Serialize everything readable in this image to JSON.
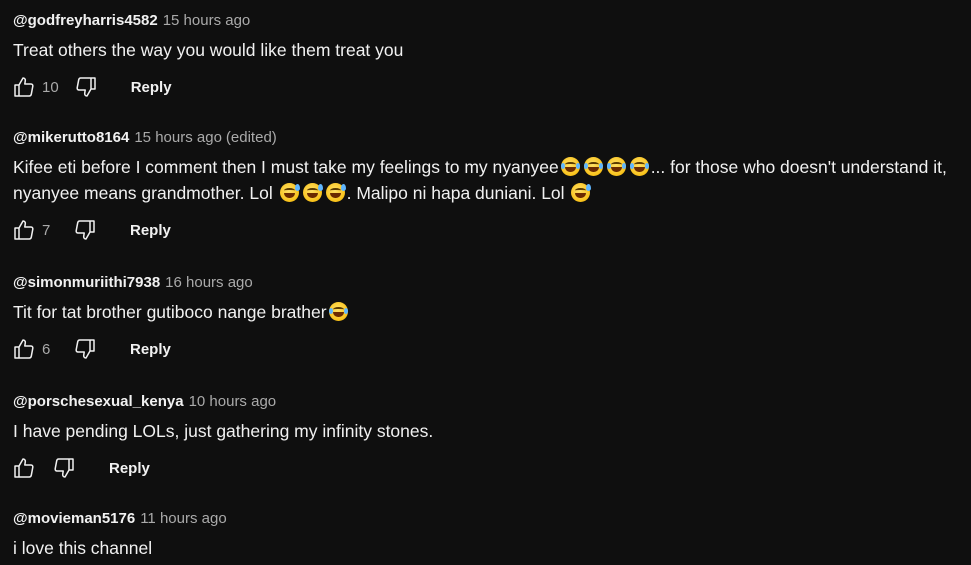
{
  "comments": [
    {
      "handle": "@godfreyharris4582",
      "time": "15 hours ago",
      "edited": "",
      "text": "Treat others the way you would like them treat you",
      "likes": "10",
      "reply": "Reply"
    },
    {
      "handle": "@mikerutto8164",
      "time": "15 hours ago",
      "edited": "(edited)",
      "text_line1_a": "Kifee eti before I comment then I must take my feelings to my nyanyee",
      "text_line1_b": "... for those who doesn't understand it,",
      "text_line2_a": "nyanyee means grandmother.  Lol ",
      "text_line2_b": ".  Malipo ni hapa duniani. Lol ",
      "likes": "7",
      "reply": "Reply"
    },
    {
      "handle": "@simonmuriithi7938",
      "time": "16 hours ago",
      "edited": "",
      "text": "Tit for tat brother gutiboco nange brather",
      "likes": "6",
      "reply": "Reply"
    },
    {
      "handle": "@porschesexual_kenya",
      "time": "10 hours ago",
      "edited": "",
      "text": "I have pending LOLs, just gathering my infinity stones.",
      "likes": "",
      "reply": "Reply"
    },
    {
      "handle": "@movieman5176",
      "time": "11 hours ago",
      "edited": "",
      "text": "i love this channel"
    }
  ],
  "icons": {
    "like": "thumbs-up-icon",
    "dislike": "thumbs-down-icon",
    "emoji_tears": "face-with-tears-of-joy-emoji",
    "emoji_sweat": "grinning-face-with-sweat-emoji"
  },
  "colors": {
    "background": "#0f0f0f",
    "primary_text": "#f1f1f1",
    "secondary_text": "#aaaaaa"
  }
}
